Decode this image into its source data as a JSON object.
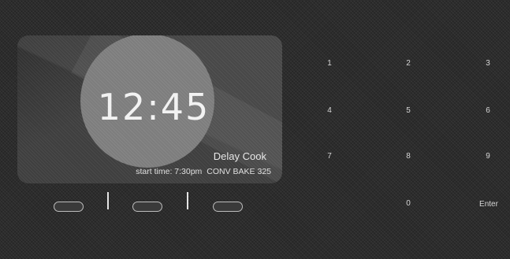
{
  "display": {
    "time": "12:45",
    "mode": "Delay Cook",
    "start_time": "start time:  7:30pm",
    "program": "CONV BAKE 325"
  },
  "keypad": {
    "keys": [
      "1",
      "2",
      "3",
      "4",
      "5",
      "6",
      "7",
      "8",
      "9",
      "0",
      "Enter"
    ]
  }
}
